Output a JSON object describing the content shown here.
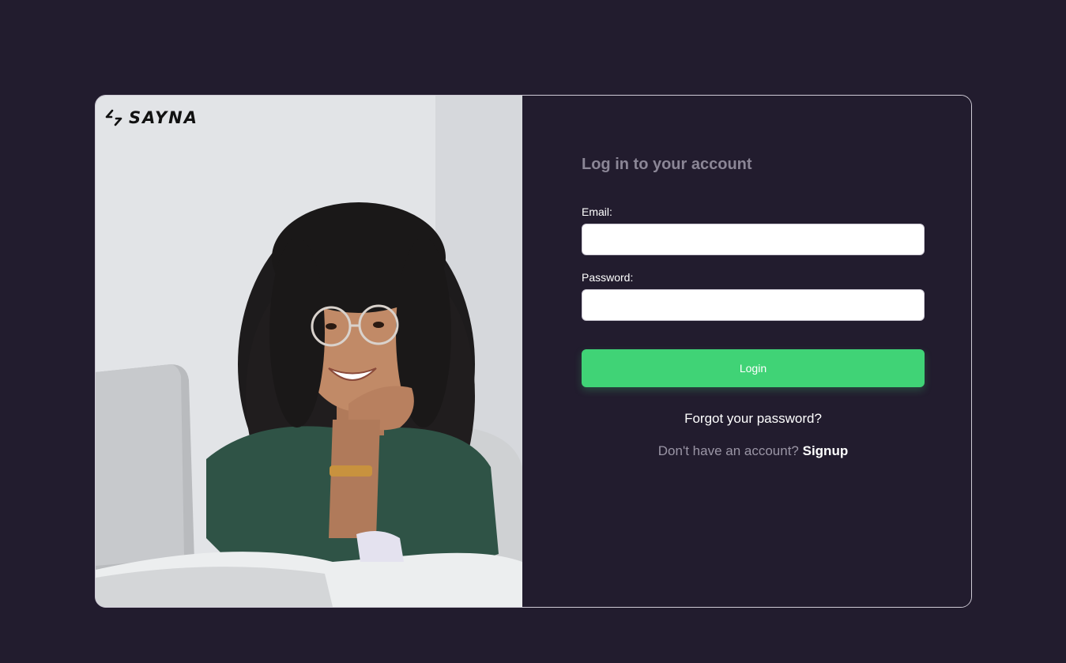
{
  "brand": {
    "name": "SAYNA",
    "logo_icon": "sayna-logo-icon"
  },
  "photo": {
    "description_icon": "woman-with-laptop-photo"
  },
  "form": {
    "title": "Log in to your account",
    "email_label": "Email:",
    "email_value": "",
    "email_placeholder": "",
    "password_label": "Password:",
    "password_value": "",
    "password_placeholder": "",
    "login_label": "Login",
    "forgot_label": "Forgot your password?",
    "signup_prompt": "Don't have an account?",
    "signup_label": "Signup"
  },
  "colors": {
    "background": "#221c2e",
    "accent": "#40d376",
    "muted_text": "#8b8696",
    "border": "#cfcbd6"
  }
}
